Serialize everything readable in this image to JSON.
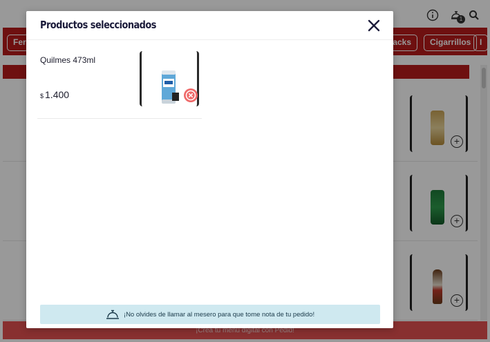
{
  "background": {
    "header": {
      "bell_badge": "1"
    },
    "categories": [
      "Ferr",
      "nacks",
      "Cigarrillos",
      "I"
    ],
    "footer_text": "¡Crea tu menú digital con Pedid!"
  },
  "modal": {
    "title": "Productos seleccionados",
    "items": [
      {
        "name": "Quilmes 473ml",
        "currency": "$",
        "price": "1.400"
      }
    ],
    "notice": "¡No olvides de llamar al mesero para que tome nota de tu pedido!"
  },
  "colors": {
    "brand_red": "#b71c1c",
    "notice_bg": "#cfe9f0",
    "remove_red": "#ef6a6a"
  }
}
